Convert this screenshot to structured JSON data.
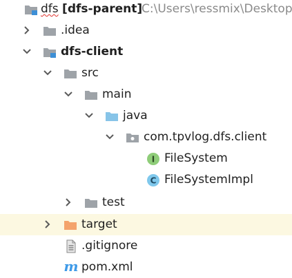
{
  "project": {
    "name": "dfs",
    "module": "[dfs-parent]",
    "path": "C:\\Users\\ressmix\\Desktop"
  },
  "items": [
    {
      "label": ".idea"
    },
    {
      "label": "dfs-client"
    },
    {
      "label": "src"
    },
    {
      "label": "main"
    },
    {
      "label": "java"
    },
    {
      "label": "com.tpvlog.dfs.client"
    },
    {
      "label": "FileSystem",
      "badge": "I"
    },
    {
      "label": "FileSystemImpl",
      "badge": "C"
    },
    {
      "label": "test"
    },
    {
      "label": "target"
    },
    {
      "label": ".gitignore"
    },
    {
      "label": "pom.xml",
      "badge": "m"
    }
  ],
  "colors": {
    "folder_gray": "#9ea3a8",
    "source_folder": "#87c4e8",
    "excluded_folder": "#f4a36c",
    "module_marker": "#3d8fd6",
    "interface_badge": "#8fcd79",
    "class_badge": "#7fc8ec",
    "maven_blue": "#3e9ae8",
    "selection_highlight": "#fcf8e1"
  }
}
